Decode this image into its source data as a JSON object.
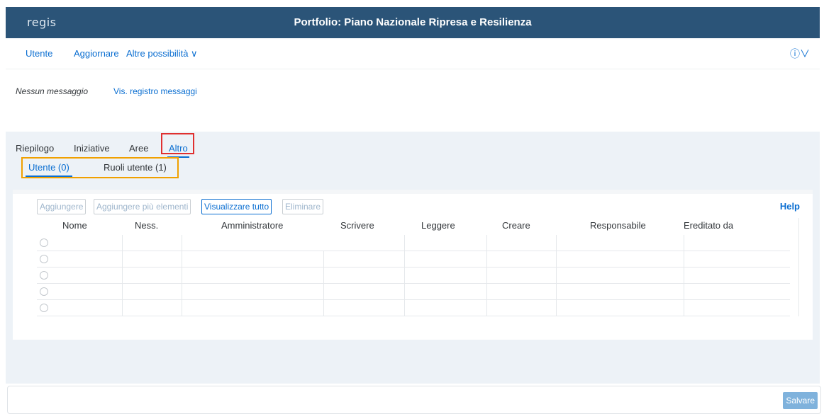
{
  "header": {
    "logo": "regis",
    "title": "Portfolio: Piano Nazionale Ripresa e Resilienza"
  },
  "menu": {
    "user": "Utente",
    "refresh": "Aggiornare",
    "more": "Altre possibilità ∨",
    "help_icon": "ⓘ∨"
  },
  "messages": {
    "none": "Nessun messaggio",
    "log": "Vis. registro messaggi"
  },
  "tabs": [
    "Riepilogo",
    "Iniziative",
    "Aree",
    "Altro"
  ],
  "subtabs": [
    "Utente (0)",
    "Ruoli utente (1)"
  ],
  "toolbar": {
    "add": "Aggiungere",
    "add_multiple": "Aggiungere più elementi",
    "show_all": "Visualizzare tutto",
    "delete": "Eliminare",
    "help": "Help"
  },
  "table": {
    "columns": [
      "Nome",
      "Ness.",
      "Amministratore",
      "Scrivere",
      "Leggere",
      "Creare",
      "Responsabile",
      "Ereditato da"
    ],
    "rows": 5
  },
  "footer": {
    "save": "Salvare"
  },
  "colors": {
    "brand": "#2b5478",
    "accent": "#0a6ed1",
    "highlight_red": "#e03030",
    "highlight_orange": "#f0a000"
  }
}
